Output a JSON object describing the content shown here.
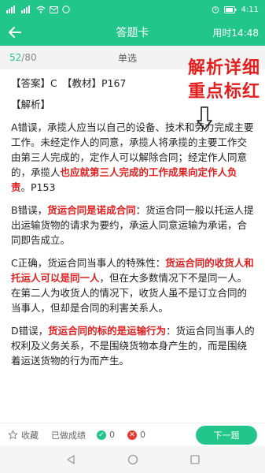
{
  "status_bar": {
    "time": "4:11",
    "carrier": "令",
    "signal_left": "⋯"
  },
  "header": {
    "title": "答题卡",
    "timer": "用时14:48"
  },
  "sub_header": {
    "progress_current": "52",
    "progress_total": "/80",
    "question_type": "单选"
  },
  "overlay": {
    "line1": "解析详细",
    "line2": "重点标红"
  },
  "content": {
    "answer_line": "【答案】C　【教材】P167",
    "analysis_label": "【解析】",
    "para_a": [
      {
        "t": "A错误，承揽人应当以自己的设备、技术和劳力完成主要工作。未经定作人的同意，承揽人将承揽的主要工作交由第三人完成的，定作人可以解除合同；经定作人同意的，承揽人",
        "red": false
      },
      {
        "t": "也应就第三人完成的工作成果向定作人负责",
        "red": true
      },
      {
        "t": "。P153",
        "red": false
      }
    ],
    "para_b": [
      {
        "t": "B错误，",
        "red": false
      },
      {
        "t": "货运合同是诺成合同",
        "red": true
      },
      {
        "t": "：货运合同一般以托运人提出运输货物的请求为要约，承运人同意运输为承诺，合同即告成立。",
        "red": false
      }
    ],
    "para_c": [
      {
        "t": "C正确，货运合同当事人的特殊性：",
        "red": false
      },
      {
        "t": "货运合同的收货人和托运人可以是同一人",
        "red": true
      },
      {
        "t": "，但在大多数情况下不是同一人。在第二人为收货人的情况下，收货人虽不是订立合同的当事人，但却是合同的利害关系人。",
        "red": false
      }
    ],
    "para_d": [
      {
        "t": "D错误，",
        "red": false
      },
      {
        "t": "货运合同的标的是运输行为",
        "red": true
      },
      {
        "t": "：货运合同当事人的权利及义务关系，不是围绕货物本身产生的，而是围绕着运送货物的行为而产生。",
        "red": false
      }
    ]
  },
  "bottom_bar": {
    "favorite_label": "收藏",
    "done_label": "已做成绩",
    "correct_count": "0",
    "wrong_count": "0",
    "next_label": "下一题"
  },
  "colors": {
    "accent": "#22c68a",
    "highlight": "#e02020"
  }
}
